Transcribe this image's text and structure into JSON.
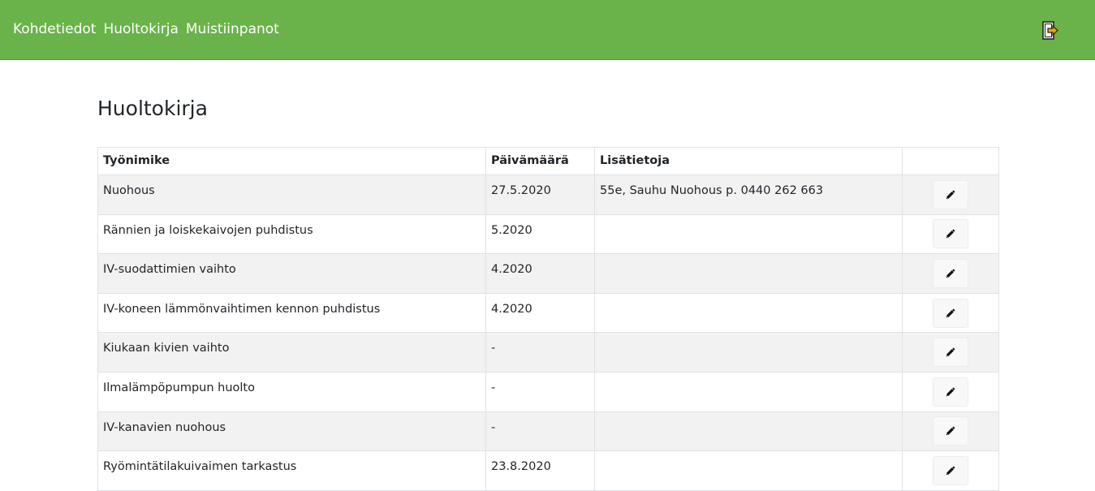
{
  "nav": {
    "items": [
      "Kohdetiedot",
      "Huoltokirja",
      "Muistiinpanot"
    ]
  },
  "header": {
    "logout_icon": "logout-icon"
  },
  "page": {
    "title": "Huoltokirja"
  },
  "table": {
    "columns": [
      "Työnimike",
      "Päivämäärä",
      "Lisätietoja",
      ""
    ],
    "rows": [
      {
        "task": "Nuohous",
        "date": "27.5.2020",
        "info": "55e, Sauhu Nuohous p. 0440 262 663"
      },
      {
        "task": "Rännien ja loiskekaivojen puhdistus",
        "date": "5.2020",
        "info": ""
      },
      {
        "task": "IV-suodattimien vaihto",
        "date": "4.2020",
        "info": ""
      },
      {
        "task": "IV-koneen lämmönvaihtimen kennon puhdistus",
        "date": "4.2020",
        "info": ""
      },
      {
        "task": "Kiukaan kivien vaihto",
        "date": "-",
        "info": ""
      },
      {
        "task": "Ilmalämpöpumpun huolto",
        "date": "-",
        "info": ""
      },
      {
        "task": "IV-kanavien nuohous",
        "date": "-",
        "info": ""
      },
      {
        "task": "Ryömintätilakuivaimen tarkastus",
        "date": "23.8.2020",
        "info": ""
      }
    ],
    "edit_icon": "pencil-icon"
  },
  "colors": {
    "header_bg": "#6ab34a",
    "stripe_bg": "#f2f2f2"
  }
}
